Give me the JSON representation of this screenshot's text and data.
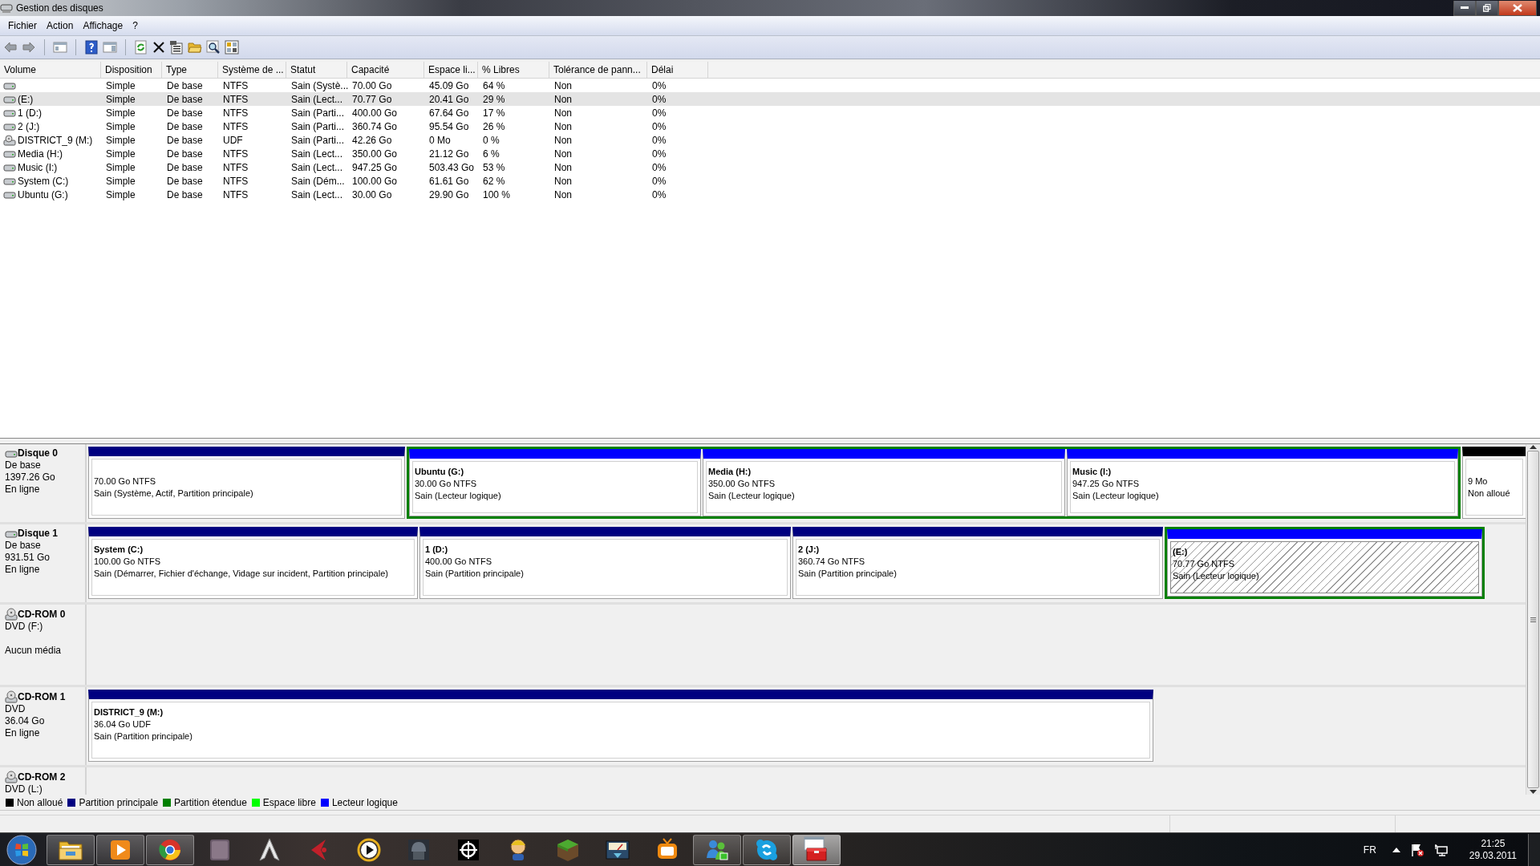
{
  "window": {
    "title": "Gestion des disques"
  },
  "menu": [
    {
      "label": "Fichier"
    },
    {
      "label": "Action"
    },
    {
      "label": "Affichage"
    },
    {
      "label": "?"
    }
  ],
  "toolbar": [
    {
      "kind": "back"
    },
    {
      "kind": "forward"
    },
    {
      "kind": "sep"
    },
    {
      "kind": "tree"
    },
    {
      "kind": "sep"
    },
    {
      "kind": "help"
    },
    {
      "kind": "pane"
    },
    {
      "kind": "sep"
    },
    {
      "kind": "refresh"
    },
    {
      "kind": "delete"
    },
    {
      "kind": "properties"
    },
    {
      "kind": "open"
    },
    {
      "kind": "search"
    },
    {
      "kind": "settings"
    }
  ],
  "volumes": {
    "columns": [
      "Volume",
      "Disposition",
      "Type",
      "Système de ...",
      "Statut",
      "Capacité",
      "Espace li...",
      "% Libres",
      "Tolérance de pann...",
      "Délai"
    ],
    "rows": [
      {
        "kind": "hdd",
        "selected": false,
        "cells": [
          "",
          "Simple",
          "De base",
          "NTFS",
          "Sain (Systè...",
          "70.00 Go",
          "45.09 Go",
          "64 %",
          "Non",
          "0%"
        ]
      },
      {
        "kind": "hdd",
        "selected": true,
        "cells": [
          "(E:)",
          "Simple",
          "De base",
          "NTFS",
          "Sain (Lect...",
          "70.77 Go",
          "20.41 Go",
          "29 %",
          "Non",
          "0%"
        ]
      },
      {
        "kind": "hdd",
        "selected": false,
        "cells": [
          "1 (D:)",
          "Simple",
          "De base",
          "NTFS",
          "Sain (Parti...",
          "400.00 Go",
          "67.64 Go",
          "17 %",
          "Non",
          "0%"
        ]
      },
      {
        "kind": "hdd",
        "selected": false,
        "cells": [
          "2 (J:)",
          "Simple",
          "De base",
          "NTFS",
          "Sain (Parti...",
          "360.74 Go",
          "95.54 Go",
          "26 %",
          "Non",
          "0%"
        ]
      },
      {
        "kind": "cdrom",
        "selected": false,
        "cells": [
          "DISTRICT_9 (M:)",
          "Simple",
          "De base",
          "UDF",
          "Sain (Parti...",
          "42.26 Go",
          "0 Mo",
          "0 %",
          "Non",
          "0%"
        ]
      },
      {
        "kind": "hdd",
        "selected": false,
        "cells": [
          "Media (H:)",
          "Simple",
          "De base",
          "NTFS",
          "Sain (Lect...",
          "350.00 Go",
          "21.12 Go",
          "6 %",
          "Non",
          "0%"
        ]
      },
      {
        "kind": "hdd",
        "selected": false,
        "cells": [
          "Music (I:)",
          "Simple",
          "De base",
          "NTFS",
          "Sain (Lect...",
          "947.25 Go",
          "503.43 Go",
          "53 %",
          "Non",
          "0%"
        ]
      },
      {
        "kind": "hdd",
        "selected": false,
        "cells": [
          "System (C:)",
          "Simple",
          "De base",
          "NTFS",
          "Sain (Dém...",
          "100.00 Go",
          "61.61 Go",
          "62 %",
          "Non",
          "0%"
        ]
      },
      {
        "kind": "hdd",
        "selected": false,
        "cells": [
          "Ubuntu (G:)",
          "Simple",
          "De base",
          "NTFS",
          "Sain (Lect...",
          "30.00 Go",
          "29.90 Go",
          "100 %",
          "Non",
          "0%"
        ]
      }
    ]
  },
  "disks": [
    {
      "kind": "disk",
      "name": "Disque 0",
      "type": "De base",
      "size": "1397.26 Go",
      "status": "En ligne",
      "partitions": [
        {
          "kind": "primary",
          "selected": false,
          "size": "70.00 Go NTFS",
          "status": "Sain (Système, Actif, Partition principale)"
        },
        {
          "kind": "extended",
          "children": [
            {
              "kind": "logical",
              "selected": false,
              "name": "Ubuntu  (G:)",
              "size": "30.00 Go NTFS",
              "status": "Sain (Lecteur logique)"
            },
            {
              "kind": "logical",
              "selected": false,
              "name": "Media  (H:)",
              "size": "350.00 Go NTFS",
              "status": "Sain (Lecteur logique)"
            },
            {
              "kind": "logical",
              "selected": false,
              "name": "Music  (I:)",
              "size": "947.25 Go NTFS",
              "status": "Sain (Lecteur logique)"
            }
          ]
        },
        {
          "kind": "unallocated",
          "selected": false,
          "size": "9 Mo",
          "status": "Non alloué"
        }
      ]
    },
    {
      "kind": "disk",
      "name": "Disque 1",
      "type": "De base",
      "size": "931.51 Go",
      "status": "En ligne",
      "partitions": [
        {
          "kind": "primary",
          "selected": false,
          "name": "System  (C:)",
          "size": "100.00 Go NTFS",
          "status": "Sain (Démarrer, Fichier d'échange, Vidage sur incident, Partition principale)"
        },
        {
          "kind": "primary",
          "selected": false,
          "name": "1  (D:)",
          "size": "400.00 Go NTFS",
          "status": "Sain (Partition principale)"
        },
        {
          "kind": "primary",
          "selected": false,
          "name": "2  (J:)",
          "size": "360.74 Go NTFS",
          "status": "Sain (Partition principale)"
        },
        {
          "kind": "extended",
          "children": [
            {
              "kind": "logical",
              "selected": true,
              "name": "(E:)",
              "size": "70.77 Go NTFS",
              "status": "Sain (Lecteur logique)"
            }
          ]
        }
      ]
    },
    {
      "kind": "cdrom",
      "name": "CD-ROM 0",
      "type": "DVD (F:)",
      "status": "Aucun média"
    },
    {
      "kind": "cdrom",
      "name": "CD-ROM 1",
      "type": "DVD",
      "size": "36.04 Go",
      "status": "En ligne",
      "partitions": [
        {
          "kind": "primary",
          "selected": false,
          "name": "DISTRICT_9  (M:)",
          "size": "36.04 Go UDF",
          "status": "Sain (Partition principale)"
        }
      ]
    },
    {
      "kind": "cdrom",
      "name": "CD-ROM 2",
      "type": "DVD (L:)"
    }
  ],
  "legend": [
    {
      "label": "Non alloué",
      "color": "#000000"
    },
    {
      "label": "Partition principale",
      "color": "#000080"
    },
    {
      "label": "Partition étendue",
      "color": "#008000"
    },
    {
      "label": "Espace libre",
      "color": "#00ff00"
    },
    {
      "label": "Lecteur logique",
      "color": "#0000ff"
    }
  ],
  "taskbar": {
    "items": [
      {
        "kind": "folder",
        "running": true,
        "active": false
      },
      {
        "kind": "media",
        "running": true,
        "active": false
      },
      {
        "kind": "browser",
        "running": true,
        "active": false
      },
      {
        "kind": "tile",
        "running": false,
        "active": false
      },
      {
        "kind": "triangle",
        "running": false,
        "active": false
      },
      {
        "kind": "redarrow",
        "running": false,
        "active": false
      },
      {
        "kind": "playring",
        "running": false,
        "active": false
      },
      {
        "kind": "helmet",
        "running": false,
        "active": false
      },
      {
        "kind": "crosshair",
        "running": false,
        "active": false
      },
      {
        "kind": "figure",
        "running": false,
        "active": false
      },
      {
        "kind": "cube",
        "running": false,
        "active": false
      },
      {
        "kind": "meter",
        "running": false,
        "active": false
      },
      {
        "kind": "tv",
        "running": false,
        "active": false
      },
      {
        "kind": "people",
        "running": true,
        "active": false
      },
      {
        "kind": "chat",
        "running": true,
        "active": false
      },
      {
        "kind": "toolbox",
        "running": true,
        "active": true
      }
    ],
    "language": "FR",
    "time": "21:25",
    "date": "29.03.2011"
  }
}
